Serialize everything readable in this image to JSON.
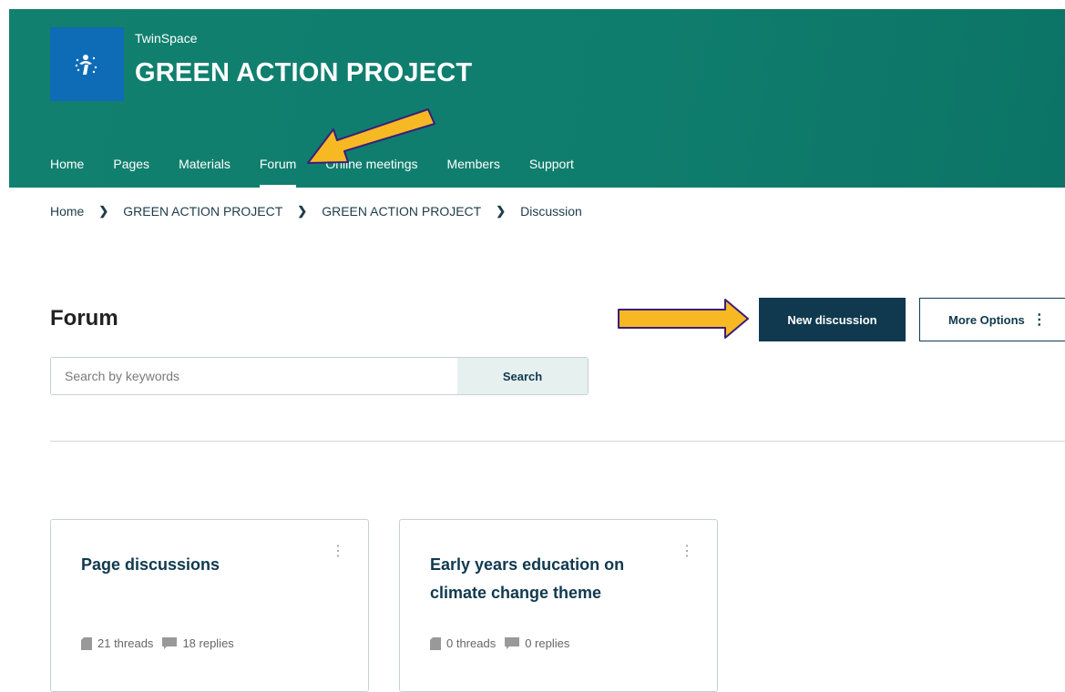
{
  "header": {
    "brand_small": "TwinSpace",
    "project_title": "GREEN ACTION PROJECT",
    "nav": [
      {
        "label": "Home"
      },
      {
        "label": "Pages"
      },
      {
        "label": "Materials"
      },
      {
        "label": "Forum"
      },
      {
        "label": "Online meetings"
      },
      {
        "label": "Members"
      },
      {
        "label": "Support"
      }
    ],
    "active_nav": "Forum",
    "colors": {
      "header": "#12806f",
      "logo": "#0e6bb5"
    }
  },
  "breadcrumb": [
    {
      "label": "Home"
    },
    {
      "label": "GREEN ACTION PROJECT"
    },
    {
      "label": "GREEN ACTION PROJECT"
    },
    {
      "label": "Discussion"
    }
  ],
  "page": {
    "title": "Forum",
    "new_discussion_label": "New discussion",
    "more_options_label": "More Options",
    "search_placeholder": "Search by keywords",
    "search_button_label": "Search"
  },
  "cards": [
    {
      "title": "Page discussions",
      "threads": "21 threads",
      "replies": "18 replies"
    },
    {
      "title": "Early years education on climate change theme",
      "threads": "0 threads",
      "replies": "0 replies"
    }
  ],
  "icons": {
    "logo": "eu-stars-figure-icon",
    "thread": "document-icon",
    "reply": "speech-bubble-icon",
    "breadcrumb_sep": "chevron-right-icon",
    "kebab": "vertical-dots-icon"
  },
  "annotations": {
    "arrow_color": "#f7b923",
    "arrow_outline": "#3a1e7a"
  }
}
